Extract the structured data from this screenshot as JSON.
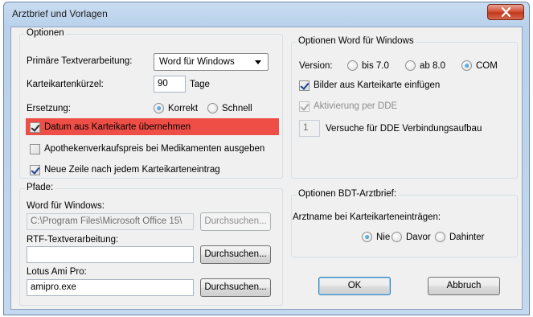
{
  "window": {
    "title": "Arztbrief und Vorlagen"
  },
  "optionen": {
    "group_label": "Optionen",
    "primaer_label": "Primäre Textverarbeitung:",
    "primaer_value": "Word für Windows",
    "kuerzel_label": "Karteikartenkürzel:",
    "kuerzel_value": "90",
    "kuerzel_unit": "Tage",
    "ersetzung_label": "Ersetzung:",
    "ersetzung_options": [
      "Korrekt",
      "Schnell"
    ],
    "ersetzung_selected": "Korrekt",
    "check_datum": "Datum aus Karteikarte übernehmen",
    "check_apotheken": "Apothekenverkaufspreis bei Medikamenten ausgeben",
    "check_neue_zeile": "Neue Zeile nach jedem Karteikarteneintrag"
  },
  "pfade": {
    "group_label": "Pfade:",
    "word_label": "Word für Windows:",
    "word_value": "C:\\Program Files\\Microsoft Office 15\\",
    "rtf_label": "RTF-Textverarbeitung:",
    "rtf_value": "",
    "lotus_label": "Lotus Ami Pro:",
    "lotus_value": "amipro.exe",
    "browse_label": "Durchsuchen..."
  },
  "word_optionen": {
    "group_label": "Optionen Word für Windows",
    "version_label": "Version:",
    "version_options": [
      "bis 7.0",
      "ab 8.0",
      "COM"
    ],
    "version_selected": "COM",
    "check_bilder": "Bilder aus Karteikarte einfügen",
    "check_dde": "Aktivierung per DDE",
    "dde_count": "1",
    "dde_label": "Versuche für DDE Verbindungsaufbau"
  },
  "bdt": {
    "group_label": "Optionen BDT-Arztbrief:",
    "arztname_label": "Arztname bei Karteikarteneinträgen:",
    "arztname_options": [
      "Nie",
      "Davor",
      "Dahinter"
    ],
    "arztname_selected": "Nie"
  },
  "buttons": {
    "ok": "OK",
    "abbruch": "Abbruch"
  },
  "colors": {
    "highlight": "#ee4e45",
    "title_bar": "#b9d1ec",
    "close_button": "#c2381c"
  }
}
